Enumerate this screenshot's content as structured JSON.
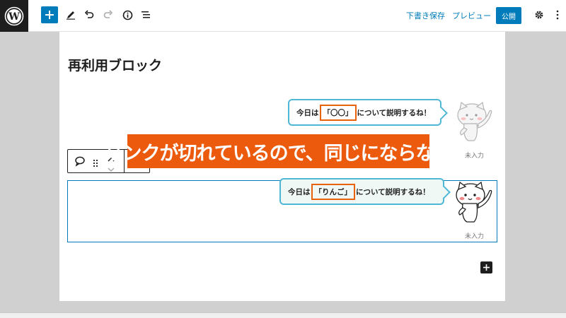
{
  "toolbar": {
    "save_draft": "下書き保存",
    "preview": "プレビュー",
    "publish": "公開"
  },
  "post": {
    "title": "再利用ブロック"
  },
  "blocks": [
    {
      "text_before": "今日は",
      "highlight": "「〇〇」",
      "text_after": "について説明するね！",
      "caption": "未入力"
    },
    {
      "text_before": "今日は",
      "highlight": "「りんご」",
      "text_after": "について説明するね！",
      "caption": "未入力"
    }
  ],
  "annotation": {
    "text": "リンクが切れているので、同じにならない"
  },
  "colors": {
    "accent": "#007cba",
    "highlight": "#e8620c",
    "banner": "#ec5a0d",
    "bubble_border": "#4fb7d6"
  },
  "icons": [
    "wordpress-logo-icon",
    "plus-icon",
    "pencil-icon",
    "undo-icon",
    "redo-icon",
    "info-icon",
    "list-view-icon",
    "gear-icon",
    "more-vertical-icon",
    "speech-bubble-icon",
    "drag-handle-icon",
    "chevron-up-icon",
    "chevron-down-icon"
  ]
}
